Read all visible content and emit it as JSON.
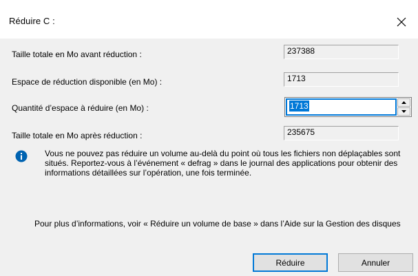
{
  "window": {
    "title": "Réduire C :",
    "close_icon": "close-icon"
  },
  "fields": {
    "total_before": {
      "label": "Taille totale en Mo avant réduction :",
      "value": "237388"
    },
    "available_shrink": {
      "label": "Espace de réduction disponible (en Mo) :",
      "value": "1713"
    },
    "amount_to_shrink": {
      "label": "Quantité d’espace à réduire (en Mo) :",
      "value": "1713"
    },
    "total_after": {
      "label": "Taille totale en Mo après réduction :",
      "value": "235675"
    }
  },
  "info": {
    "icon": "info-icon",
    "message": "Vous ne pouvez pas réduire un volume au-delà du point où tous les fichiers non déplaçables sont situés. Reportez-vous à l’événement « defrag » dans le journal des applications pour obtenir des informations détaillées sur l’opération, une fois terminée."
  },
  "more_info": "Pour plus d’informations, voir « Réduire un volume de base » dans l’Aide sur la Gestion des disques",
  "buttons": {
    "shrink_label": "Réduire",
    "cancel_label": "Annuler"
  },
  "colors": {
    "accent": "#0078d7",
    "dialog_bg": "#f0f0f0",
    "info_icon": "#0063b1"
  }
}
